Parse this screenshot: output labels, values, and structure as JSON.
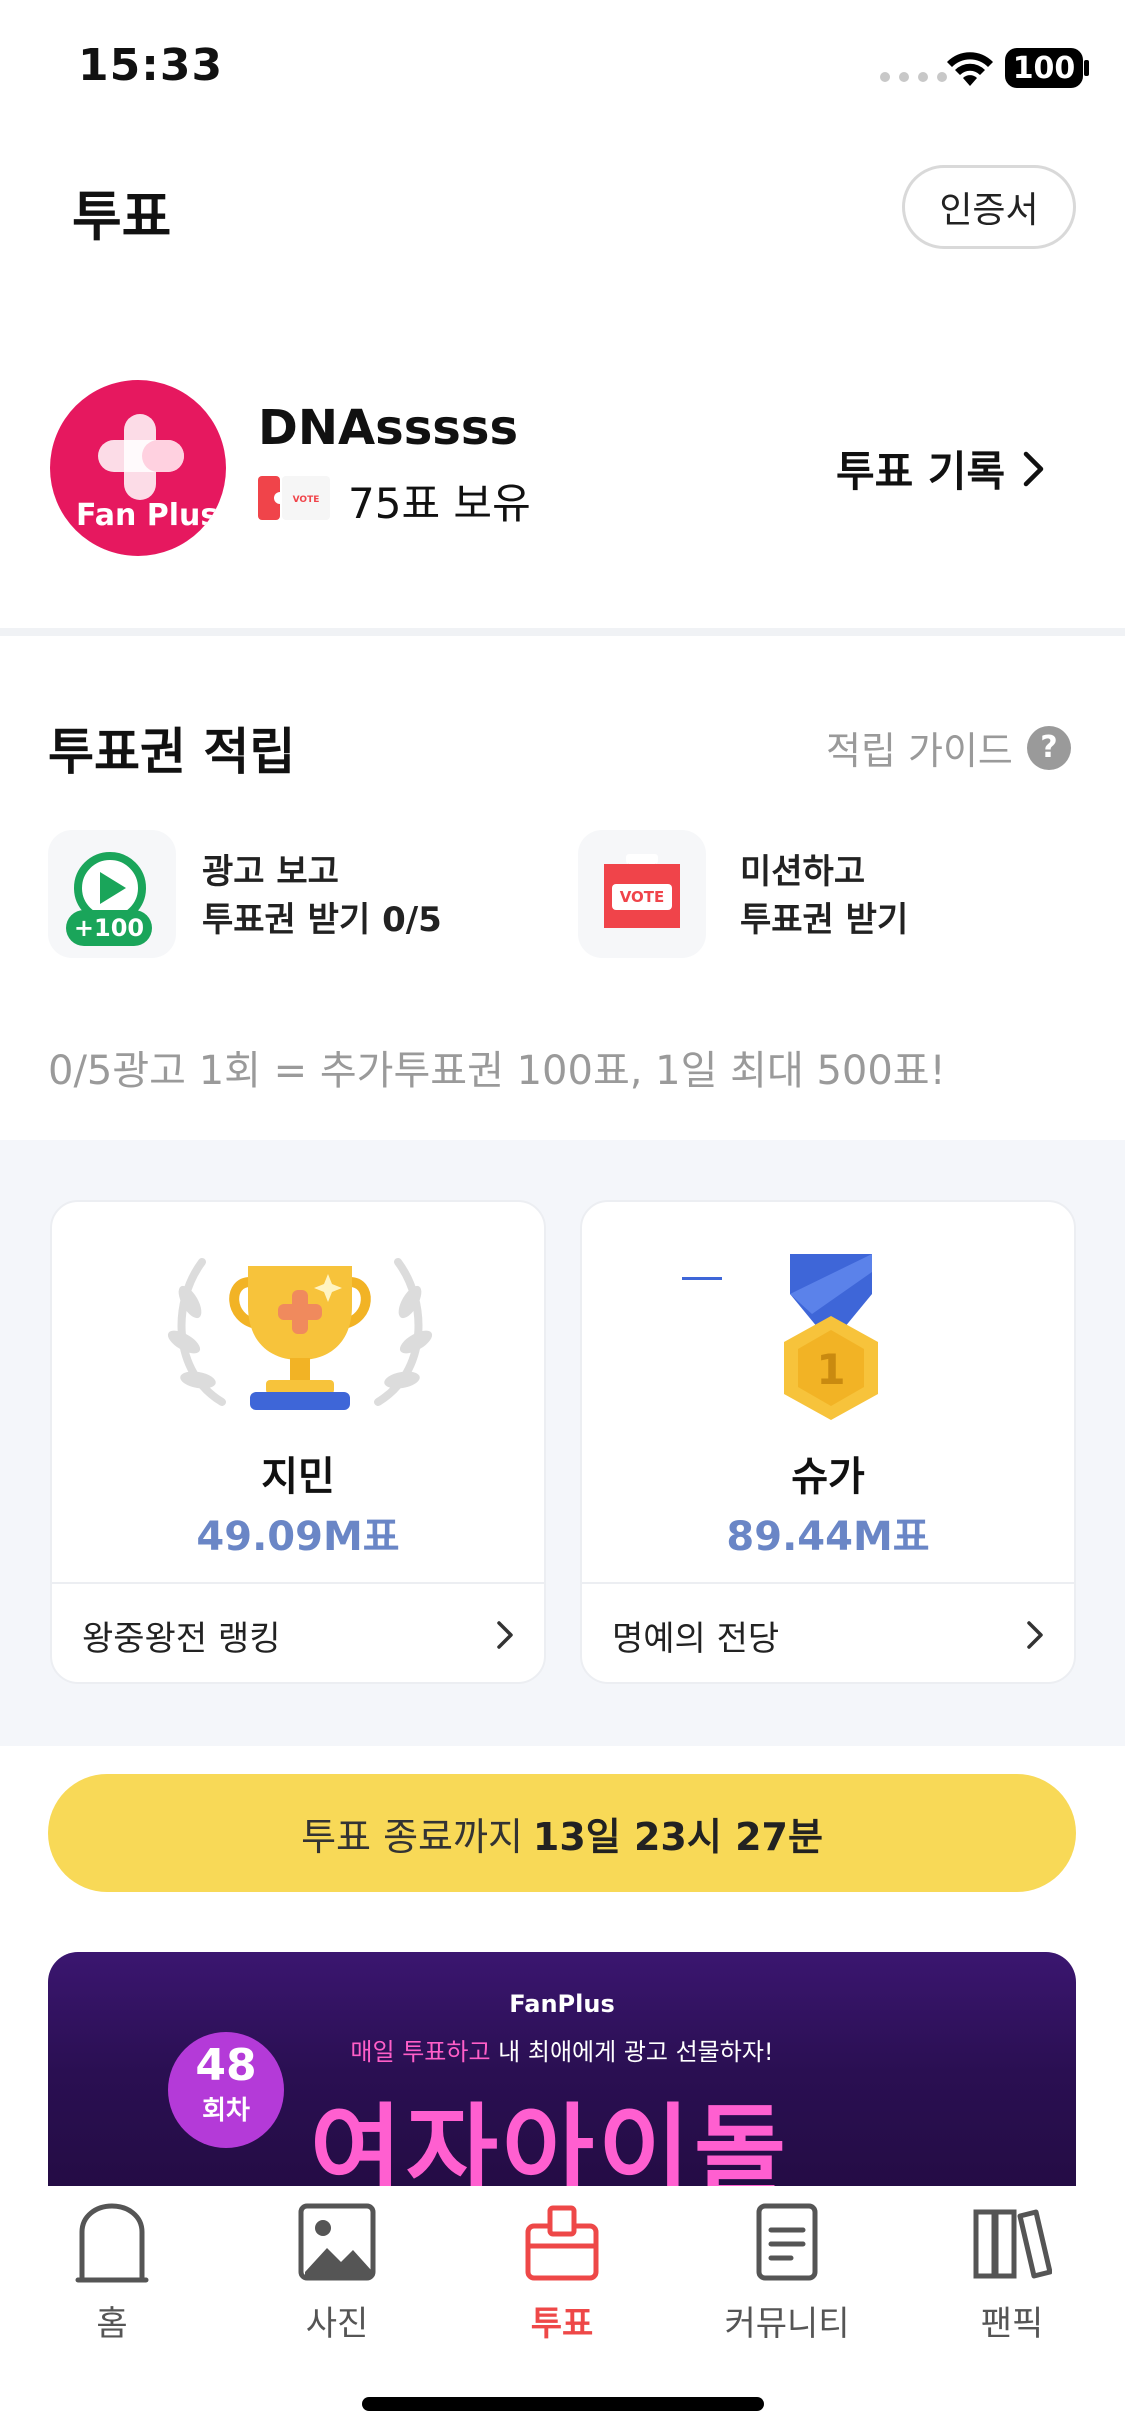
{
  "status_bar": {
    "time": "15:33",
    "battery": "100"
  },
  "header": {
    "title": "투표",
    "cert_button": "인증서"
  },
  "profile": {
    "avatar_text": "Fan Plus",
    "username": "DNAsssss",
    "ticket_label": "VOTE",
    "votes_owned": "75표 보유",
    "history_link": "투표 기록"
  },
  "earn": {
    "title": "투표권 적립",
    "guide": "적립 가이드",
    "ad_card": {
      "line1": "광고 보고",
      "line2": "투표권 받기 0/5",
      "badge": "+100"
    },
    "mission_card": {
      "line1": "미션하고",
      "line2": "투표권 받기",
      "badge": "VOTE"
    },
    "note": "0/5광고 1회 = 추가투표권 100표, 1일 최대 500표!"
  },
  "ranking": {
    "left": {
      "name": "지민",
      "votes": "49.09M표",
      "footer": "왕중왕전 랭킹"
    },
    "right": {
      "name": "슈가",
      "votes": "89.44M표",
      "footer": "명예의 전당",
      "medal_number": "1"
    }
  },
  "countdown": {
    "prefix": "투표 종료까지",
    "time": "13일 23시 27분"
  },
  "banner": {
    "brand": "FanPlus",
    "subtitle_highlight": "매일 투표하고",
    "subtitle_rest": " 내 최애에게 광고 선물하자!",
    "round_number": "48",
    "round_unit": "회차",
    "title": "여자아이돌"
  },
  "tabs": [
    {
      "label": "홈",
      "icon": "home-icon"
    },
    {
      "label": "사진",
      "icon": "photo-icon"
    },
    {
      "label": "투표",
      "icon": "vote-box-icon",
      "active": true
    },
    {
      "label": "커뮤니티",
      "icon": "document-icon"
    },
    {
      "label": "팬픽",
      "icon": "books-icon"
    }
  ],
  "colors": {
    "accent_red": "#ee4848",
    "avatar_pink": "#e6185f",
    "vote_blue": "#6a86c6",
    "countdown_yellow": "#f8d957",
    "banner_pink": "#ff5fd0"
  }
}
